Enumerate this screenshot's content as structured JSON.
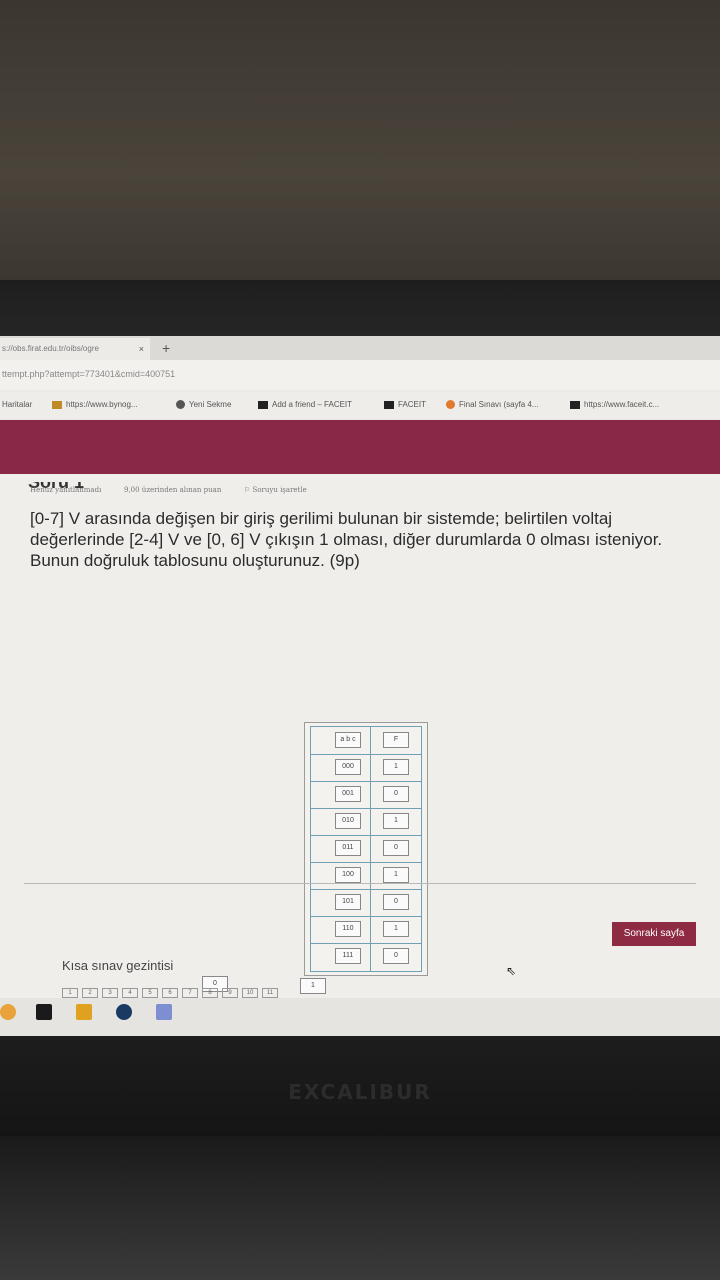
{
  "browser": {
    "tab_title": "s://obs.firat.edu.tr/oibs/ogre",
    "tab_close": "×",
    "new_tab": "+",
    "url": "ttempt.php?attempt=773401&cmid=400751",
    "bookmarks": [
      {
        "label": "Haritalar",
        "icon": "map-icon",
        "color": "#999999"
      },
      {
        "label": "https://www.bynog...",
        "icon": "bynogame-icon",
        "color": "#c08a2a"
      },
      {
        "label": "Yeni Sekme",
        "icon": "globe-icon",
        "color": "#555555"
      },
      {
        "label": "Add a friend – FACEIT",
        "icon": "faceit-icon",
        "color": "#e9620f"
      },
      {
        "label": "FACEIT",
        "icon": "faceit-icon",
        "color": "#e9620f"
      },
      {
        "label": "Final Sınavı (sayfa 4...",
        "icon": "moodle-icon",
        "color": "#e07a2f"
      },
      {
        "label": "https://www.faceit.c...",
        "icon": "faceit-icon",
        "color": "#e9620f"
      }
    ]
  },
  "quiz": {
    "question_heading": "Soru 1",
    "status": "Henüz yanıtlanmadı",
    "points": "9,00 üzerinden alınan puan",
    "flag": "Soruyu işaretle",
    "text": "[0-7] V arasında değişen bir giriş gerilimi bulunan bir sistemde; belirtilen voltaj değerlerinde [2-4] V ve [0, 6] V çıkışın 1 olması, diğer durumlarda 0 olması isteniyor. Bunun doğruluk tablosunu oluşturunuz. (9p)",
    "table": {
      "headers": [
        "a b c",
        "F"
      ],
      "rows": [
        [
          "000",
          "1"
        ],
        [
          "001",
          "0"
        ],
        [
          "010",
          "1"
        ],
        [
          "011",
          "0"
        ],
        [
          "100",
          "1"
        ],
        [
          "101",
          "0"
        ],
        [
          "110",
          "1"
        ],
        [
          "111",
          "0"
        ]
      ]
    },
    "answer_choices": [
      "0",
      "1"
    ],
    "next_button": "Sonraki sayfa",
    "nav_title": "Kısa sınav gezintisi",
    "nav_pages": [
      "1",
      "2",
      "3",
      "4",
      "5",
      "6",
      "7",
      "8",
      "9",
      "10",
      "11"
    ]
  },
  "device": {
    "brand": "EXCALIBUR"
  },
  "colors": {
    "banner": "#8a2848",
    "next_button": "#8e2a41",
    "table_border": "#6fa0b4"
  }
}
